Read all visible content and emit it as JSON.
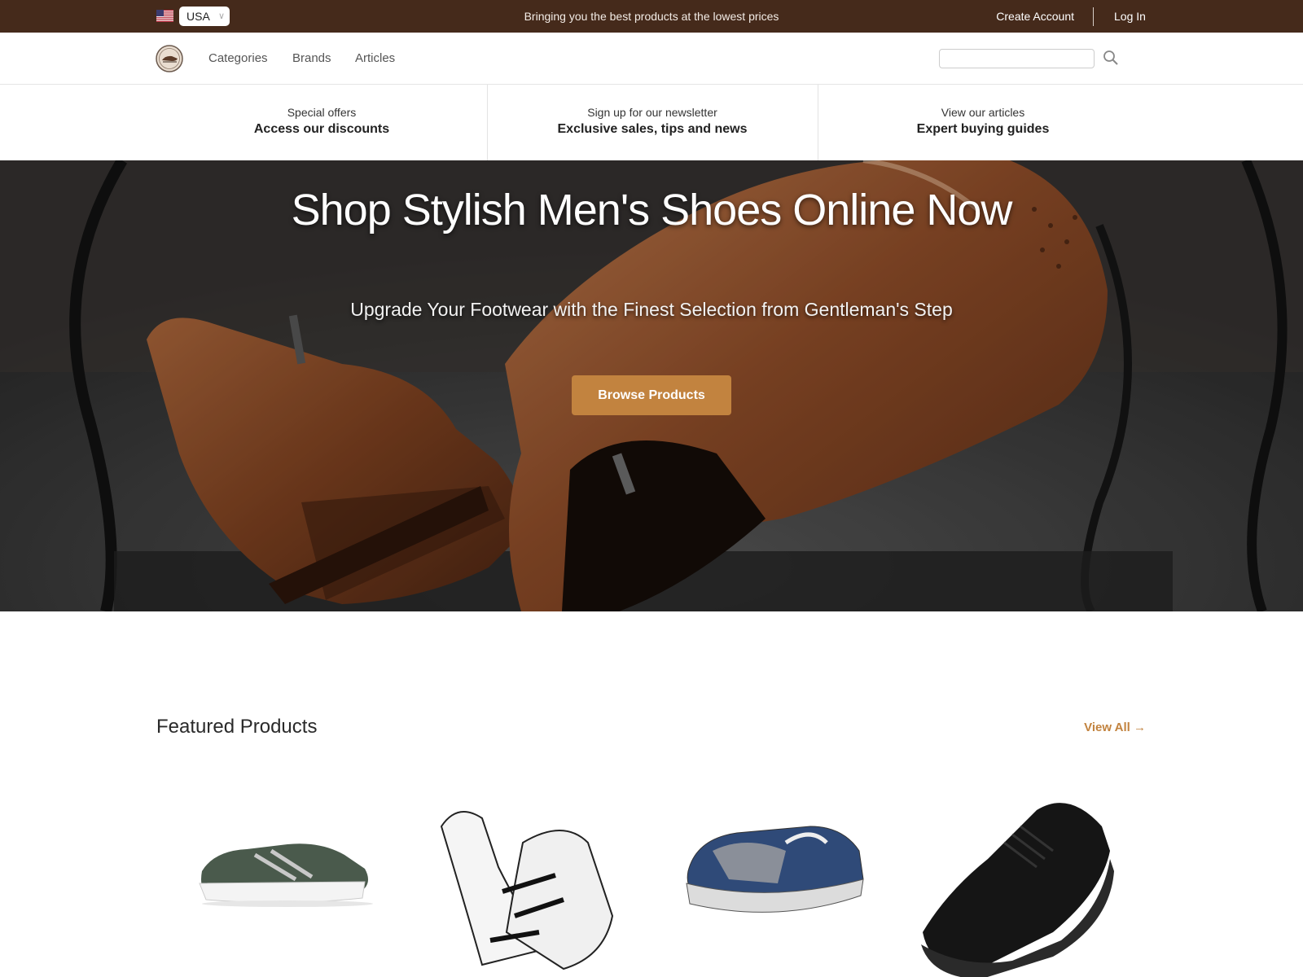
{
  "topbar": {
    "country": "USA",
    "tagline": "Bringing you the best products at the lowest prices",
    "create_account": "Create Account",
    "log_in": "Log In"
  },
  "nav": {
    "links": [
      "Categories",
      "Brands",
      "Articles"
    ],
    "search_placeholder": ""
  },
  "promos": [
    {
      "small": "Special offers",
      "big": "Access our discounts"
    },
    {
      "small": "Sign up for our newsletter",
      "big": "Exclusive sales, tips and news"
    },
    {
      "small": "View our articles",
      "big": "Expert buying guides"
    }
  ],
  "hero": {
    "title": "Shop Stylish Men's Shoes Online Now",
    "subtitle": "Upgrade Your Footwear with the Finest Selection from Gentleman's Step",
    "button": "Browse Products"
  },
  "featured": {
    "title": "Featured Products",
    "view_all": "View All →"
  },
  "colors": {
    "topbar_bg": "#452a1b",
    "accent": "#c2833f"
  },
  "icons": [
    "us-flag-icon",
    "chevron-down-icon",
    "logo",
    "search-icon"
  ]
}
